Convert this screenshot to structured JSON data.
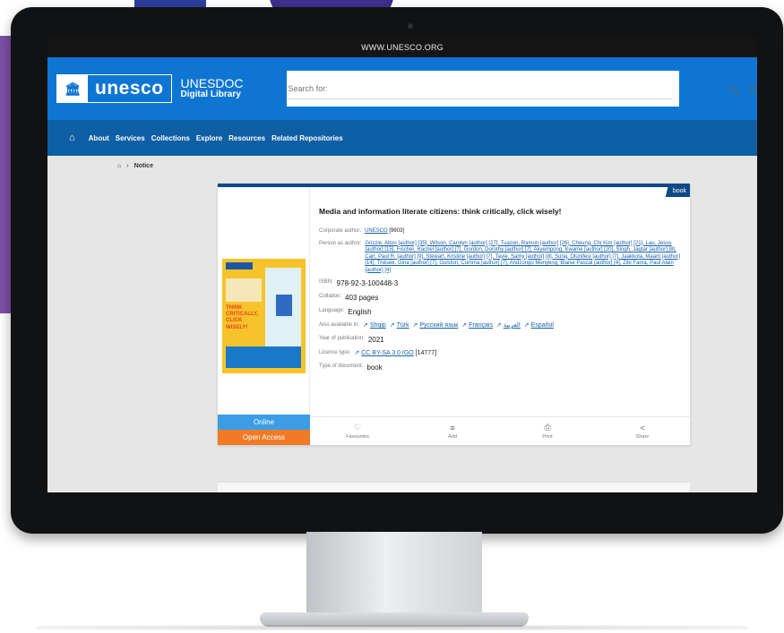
{
  "browser": {
    "url": "WWW.UNESCO.ORG"
  },
  "header": {
    "logo_word": "unesco",
    "brand_name": "UNESDOC",
    "brand_sub": "Digital Library",
    "search_placeholder": "Search for:"
  },
  "nav": {
    "items": [
      "About",
      "Services",
      "Collections",
      "Explore",
      "Resources",
      "Related Repositories"
    ]
  },
  "breadcrumb": {
    "current": "Notice"
  },
  "record": {
    "badge": "book",
    "title": "Media and information literate citizens: think critically, click wisely!",
    "corporate_author_label": "Corporate author:",
    "corporate_author": "UNESCO",
    "corporate_author_count": "[9603]",
    "person_author_label": "Person as author:",
    "person_authors": "Grizzle, Alton [author] [35], Wilson, Carolyn [author] [27], Tuazon, Ramon [author] [26], Cheung, Chi Kim [author] [21], Lau, Jesus [author] [15], Fischer, Rachel [author] [7], Gordon, Dorothy [author] [7], Akyempong, Kwame [author] [20], Singh, Jagtar [author] [8], Carr, Paul R. [author] [9], Stewart, Kristine [author] [7], Tayie, Samy [author] [8], Suraj, Olunifesi [author] [7], Jaakkola, Maarit [author] [14], Thésée, Gina [author] [7], Gulston, Cumma [author] [7], Andzongo Menyeng, Blaise Pascal [author] [4], Zibi Fama, Paul Alain [author] [4]",
    "isbn_label": "ISBN:",
    "isbn": "978-92-3-100448-3",
    "collation_label": "Collation:",
    "collation": "403 pages",
    "language_label": "Language:",
    "language": "English",
    "also_available_label": "Also available in:",
    "also_available": [
      "Shqip",
      "Türk",
      "Русский язык",
      "Français",
      "العربية",
      "Español"
    ],
    "year_label": "Year of publication:",
    "year": "2021",
    "licence_label": "Licence type:",
    "licence": "CC BY-SA 3.0 IGO",
    "licence_count": "[14777]",
    "doc_type_label": "Type of document:",
    "doc_type": "book",
    "cover_text": "THINK CRITICALLY, CLICK WISELY!"
  },
  "access": {
    "online": "Online",
    "open": "Open Access"
  },
  "actions": {
    "favourites": "Favourites",
    "add": "Add",
    "print": "Print",
    "share": "Share"
  }
}
